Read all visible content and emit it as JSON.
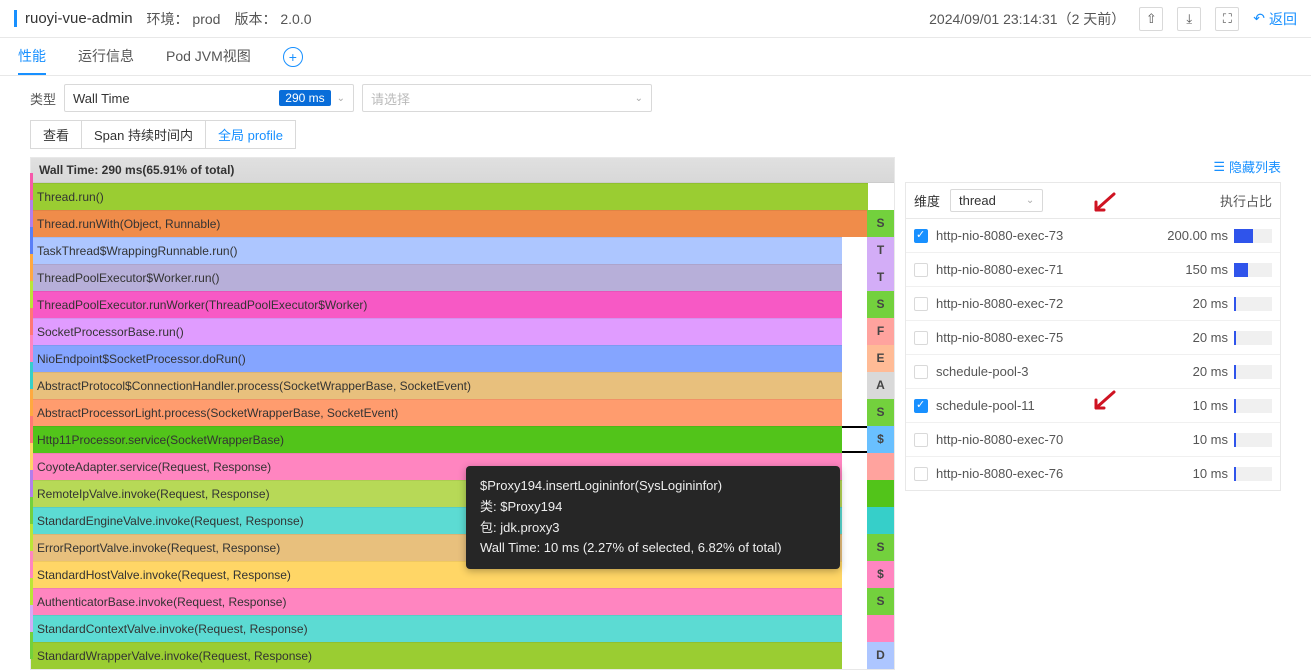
{
  "header": {
    "app_name": "ruoyi-vue-admin",
    "env": "环境： prod",
    "version": "版本： 2.0.0",
    "timestamp": "2024/09/01 23:14:31（2 天前）",
    "back": "返回"
  },
  "tabs": [
    "性能",
    "运行信息",
    "Pod JVM视图"
  ],
  "toolbar": {
    "type_label": "类型",
    "type_value": "Wall Time",
    "type_badge": "290 ms",
    "filter_placeholder": "请选择"
  },
  "toolbar2": {
    "view": "查看",
    "span": "Span 持续时间内",
    "profile": "全局 profile"
  },
  "hide_cols": "隐藏列表",
  "dimension": {
    "label": "维度",
    "value": "thread",
    "col": "执行占比"
  },
  "flame": {
    "header": "Wall Time: 290 ms(65.91% of total)",
    "rows": [
      {
        "text": "Thread.run()",
        "bg": "#9acd32",
        "w": 97.0,
        "guide": "#f759ab"
      },
      {
        "text": "Thread.runWith(Object, Runnable)",
        "bg": "#f08c4a",
        "w": 97.0,
        "tag": "S",
        "tagbg": "#73d13d",
        "guide": "#b37feb"
      },
      {
        "text": "TaskThread$WrappingRunnable.run()",
        "bg": "#adc6ff",
        "w": 94.0,
        "tag": "T",
        "tagbg": "#d3adf7",
        "guide": "#597ef7"
      },
      {
        "text": "ThreadPoolExecutor$Worker.run()",
        "bg": "#b7afd9",
        "w": 94.0,
        "tag": "T",
        "tagbg": "#d3adf7",
        "guide": "#ffa940"
      },
      {
        "text": "ThreadPoolExecutor.runWorker(ThreadPoolExecutor$Worker)",
        "bg": "#f759c5",
        "w": 94.0,
        "tag": "S",
        "tagbg": "#73d13d",
        "guide": "#bae637"
      },
      {
        "text": "SocketProcessorBase.run()",
        "bg": "#e09cff",
        "w": 94.0,
        "tag": "F",
        "tagbg": "#ffa39e",
        "guide": "#ff7875"
      },
      {
        "text": "NioEndpoint$SocketProcessor.doRun()",
        "bg": "#85a5ff",
        "w": 94.0,
        "tag": "E",
        "tagbg": "#ffbb96",
        "guide": "#ff85c0"
      },
      {
        "text": "AbstractProtocol$ConnectionHandler.process(SocketWrapperBase, SocketEvent)",
        "bg": "#e8c07d",
        "w": 94.0,
        "tag": "A",
        "tagbg": "#d9d9d9",
        "guide": "#36cfc9"
      },
      {
        "text": "AbstractProcessorLight.process(SocketWrapperBase, SocketEvent)",
        "bg": "#ff9c6e",
        "w": 94.0,
        "tag": "S",
        "tagbg": "#73d13d",
        "guide": "#ffa940"
      },
      {
        "text": "Http11Processor.service(SocketWrapperBase)",
        "bg": "#52c41a",
        "w": 94.0,
        "tag": "$",
        "tagbg": "#69c0ff",
        "sel": true,
        "guide": "#ff7875"
      },
      {
        "text": "CoyoteAdapter.service(Request, Response)",
        "bg": "#ff85c0",
        "w": 94.0,
        "tag": "",
        "tagbg": "#ffa39e",
        "guide": "#ffd666"
      },
      {
        "text": "RemoteIpValve.invoke(Request, Response)",
        "bg": "#b7d957",
        "w": 94.0,
        "tag": "",
        "tagbg": "#52c41a",
        "guide": "#b37feb"
      },
      {
        "text": "StandardEngineValve.invoke(Request, Response)",
        "bg": "#5cdbd3",
        "w": 94.0,
        "tag": "",
        "tagbg": "#36cfc9",
        "guide": "#73d13d"
      },
      {
        "text": "ErrorReportValve.invoke(Request, Response)",
        "bg": "#e8c07d",
        "w": 94.0,
        "tag": "S",
        "tagbg": "#73d13d",
        "guide": "#bae637"
      },
      {
        "text": "StandardHostValve.invoke(Request, Response)",
        "bg": "#ffd666",
        "w": 94.0,
        "tag": "$",
        "tagbg": "#ff85c0",
        "guide": "#ff85c0"
      },
      {
        "text": "AuthenticatorBase.invoke(Request, Response)",
        "bg": "#ff85c0",
        "w": 94.0,
        "tag": "S",
        "tagbg": "#73d13d",
        "guide": "#bae637"
      },
      {
        "text": "StandardContextValve.invoke(Request, Response)",
        "bg": "#5cdbd3",
        "w": 94.0,
        "tag": "",
        "tagbg": "#ff85c0",
        "guide": "#d3adf7"
      },
      {
        "text": "StandardWrapperValve.invoke(Request, Response)",
        "bg": "#9acd32",
        "w": 94.0,
        "tag": "D",
        "tagbg": "#adc6ff",
        "guide": "#73d13d"
      }
    ]
  },
  "threads": [
    {
      "name": "http-nio-8080-exec-73",
      "ms": "200.00 ms",
      "pct": 50,
      "checked": true
    },
    {
      "name": "http-nio-8080-exec-71",
      "ms": "150 ms",
      "pct": 38,
      "checked": false
    },
    {
      "name": "http-nio-8080-exec-72",
      "ms": "20 ms",
      "pct": 6,
      "checked": false
    },
    {
      "name": "http-nio-8080-exec-75",
      "ms": "20 ms",
      "pct": 6,
      "checked": false
    },
    {
      "name": "schedule-pool-3",
      "ms": "20 ms",
      "pct": 6,
      "checked": false
    },
    {
      "name": "schedule-pool-11",
      "ms": "10 ms",
      "pct": 4,
      "checked": true
    },
    {
      "name": "http-nio-8080-exec-70",
      "ms": "10 ms",
      "pct": 4,
      "checked": false
    },
    {
      "name": "http-nio-8080-exec-76",
      "ms": "10 ms",
      "pct": 4,
      "checked": false
    }
  ],
  "tooltip": {
    "title": "$Proxy194.insertLogininfor(SysLogininfor)",
    "class": "类: $Proxy194",
    "pkg": "包: jdk.proxy3",
    "wall": "Wall Time: 10 ms (2.27% of selected, 6.82% of total)"
  }
}
